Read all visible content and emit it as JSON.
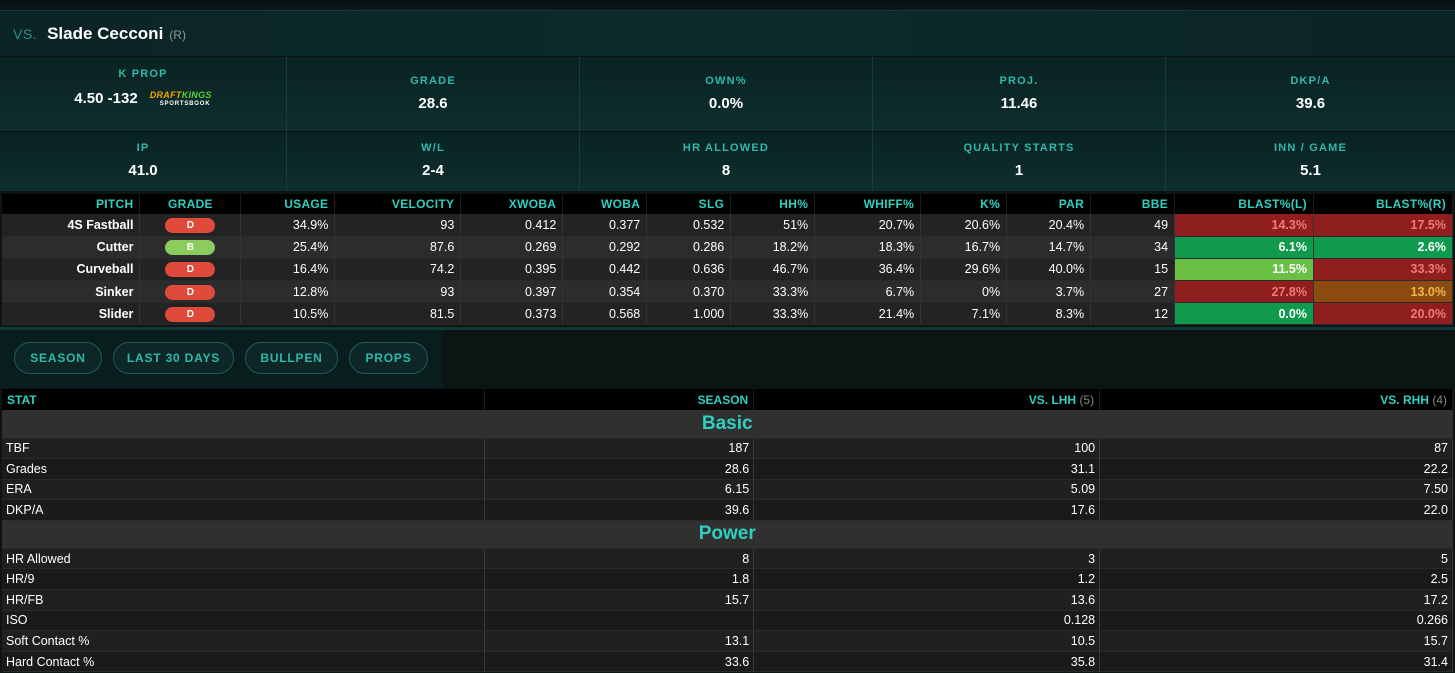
{
  "header": {
    "vs": "VS.",
    "pitcher": "Slade Cecconi",
    "hand": "(R)"
  },
  "summary_row1": [
    {
      "label": "K PROP",
      "value": "4.50 -132",
      "logo": {
        "top_a": "DRAFT",
        "top_b": "KINGS",
        "bottom": "SPORTSBOOK"
      }
    },
    {
      "label": "GRADE",
      "value": "28.6"
    },
    {
      "label": "OWN%",
      "value": "0.0%"
    },
    {
      "label": "PROJ.",
      "value": "11.46"
    },
    {
      "label": "DKP/A",
      "value": "39.6"
    }
  ],
  "summary_row2": [
    {
      "label": "IP",
      "value": "41.0"
    },
    {
      "label": "W/L",
      "value": "2-4"
    },
    {
      "label": "HR ALLOWED",
      "value": "8"
    },
    {
      "label": "QUALITY STARTS",
      "value": "1"
    },
    {
      "label": "INN / GAME",
      "value": "5.1"
    }
  ],
  "pitch_table": {
    "headers": [
      "PITCH",
      "GRADE",
      "USAGE",
      "VELOCITY",
      "XWOBA",
      "WOBA",
      "SLG",
      "HH%",
      "WHIFF%",
      "K%",
      "PAR",
      "BBE",
      "BLAST%(L)",
      "BLAST%(R)"
    ],
    "rows": [
      {
        "pitch": "4S Fastball",
        "grade": "D",
        "usage": "34.9%",
        "velocity": "93",
        "xwoba": "0.412",
        "woba": "0.377",
        "slg": "0.532",
        "hh": "51%",
        "whiff": "20.7%",
        "k": "20.6%",
        "par": "20.4%",
        "bbe": "49",
        "blast_l": "14.3%",
        "blast_r": "17.5%",
        "blast_l_bg": "#8f1f1f",
        "blast_l_fg": "#f07a7a",
        "blast_r_bg": "#8f1f1f",
        "blast_r_fg": "#f07a7a"
      },
      {
        "pitch": "Cutter",
        "grade": "B",
        "usage": "25.4%",
        "velocity": "87.6",
        "xwoba": "0.269",
        "woba": "0.292",
        "slg": "0.286",
        "hh": "18.2%",
        "whiff": "18.3%",
        "k": "16.7%",
        "par": "14.7%",
        "bbe": "34",
        "blast_l": "6.1%",
        "blast_r": "2.6%",
        "blast_l_bg": "#0f9a4e",
        "blast_l_fg": "#ffffff",
        "blast_r_bg": "#0f9a4e",
        "blast_r_fg": "#ffffff"
      },
      {
        "pitch": "Curveball",
        "grade": "D",
        "usage": "16.4%",
        "velocity": "74.2",
        "xwoba": "0.395",
        "woba": "0.442",
        "slg": "0.636",
        "hh": "46.7%",
        "whiff": "36.4%",
        "k": "29.6%",
        "par": "40.0%",
        "bbe": "15",
        "blast_l": "11.5%",
        "blast_r": "33.3%",
        "blast_l_bg": "#6abf45",
        "blast_l_fg": "#ffffff",
        "blast_r_bg": "#8f1f1f",
        "blast_r_fg": "#f07a7a"
      },
      {
        "pitch": "Sinker",
        "grade": "D",
        "usage": "12.8%",
        "velocity": "93",
        "xwoba": "0.397",
        "woba": "0.354",
        "slg": "0.370",
        "hh": "33.3%",
        "whiff": "6.7%",
        "k": "0%",
        "par": "3.7%",
        "bbe": "27",
        "blast_l": "27.8%",
        "blast_r": "13.0%",
        "blast_l_bg": "#8f1f1f",
        "blast_l_fg": "#f07a7a",
        "blast_r_bg": "#8a4a10",
        "blast_r_fg": "#f0b84a"
      },
      {
        "pitch": "Slider",
        "grade": "D",
        "usage": "10.5%",
        "velocity": "81.5",
        "xwoba": "0.373",
        "woba": "0.568",
        "slg": "1.000",
        "hh": "33.3%",
        "whiff": "21.4%",
        "k": "7.1%",
        "par": "8.3%",
        "bbe": "12",
        "blast_l": "0.0%",
        "blast_r": "20.0%",
        "blast_l_bg": "#0f9a4e",
        "blast_l_fg": "#ffffff",
        "blast_r_bg": "#8f1f1f",
        "blast_r_fg": "#f07a7a"
      }
    ]
  },
  "filters": [
    "SEASON",
    "LAST 30 DAYS",
    "BULLPEN",
    "PROPS"
  ],
  "stat_table": {
    "headers": {
      "stat": "STAT",
      "season": "SEASON",
      "lhh": "VS. LHH",
      "lhh_count": "(5)",
      "rhh": "VS. RHH",
      "rhh_count": "(4)"
    },
    "sections": [
      {
        "title": "Basic",
        "rows": [
          {
            "stat": "TBF",
            "season": "187",
            "lhh": "100",
            "rhh": "87"
          },
          {
            "stat": "Grades",
            "season": "28.6",
            "lhh": "31.1",
            "rhh": "22.2"
          },
          {
            "stat": "ERA",
            "season": "6.15",
            "lhh": "5.09",
            "rhh": "7.50"
          },
          {
            "stat": "DKP/A",
            "season": "39.6",
            "lhh": "17.6",
            "rhh": "22.0"
          }
        ]
      },
      {
        "title": "Power",
        "rows": [
          {
            "stat": "HR Allowed",
            "season": "8",
            "lhh": "3",
            "rhh": "5"
          },
          {
            "stat": "HR/9",
            "season": "1.8",
            "lhh": "1.2",
            "rhh": "2.5"
          },
          {
            "stat": "HR/FB",
            "season": "15.7",
            "lhh": "13.6",
            "rhh": "17.2"
          },
          {
            "stat": "ISO",
            "season": "",
            "lhh": "0.128",
            "rhh": "0.266"
          },
          {
            "stat": "Soft Contact %",
            "season": "13.1",
            "lhh": "10.5",
            "rhh": "15.7"
          },
          {
            "stat": "Hard Contact %",
            "season": "33.6",
            "lhh": "35.8",
            "rhh": "31.4"
          }
        ]
      }
    ]
  }
}
